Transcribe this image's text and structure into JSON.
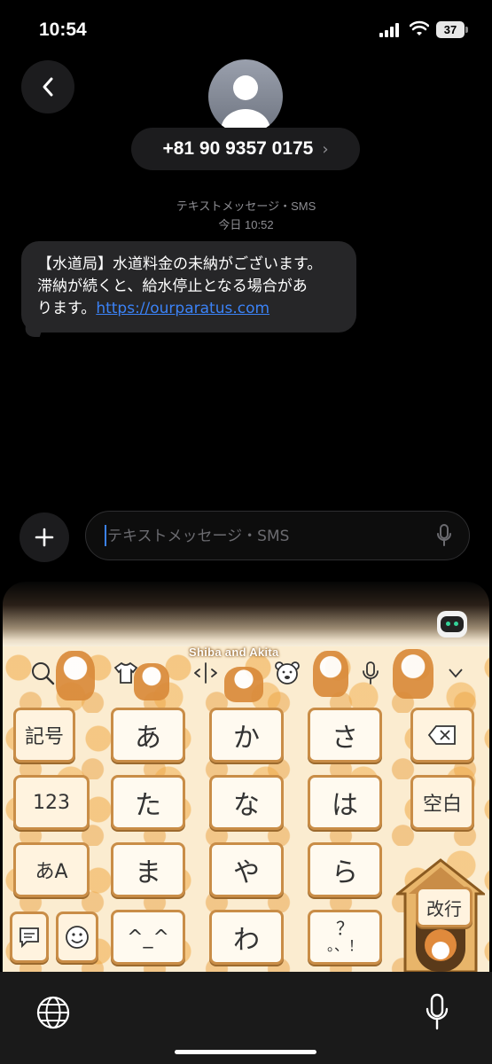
{
  "status": {
    "time": "10:54",
    "battery": "37"
  },
  "header": {
    "phone_number": "+81 90 9357 0175",
    "chevron": "›"
  },
  "conversation": {
    "label": "テキストメッセージ・SMS",
    "timestamp": "今日 10:52",
    "message": {
      "line1": "【水道局】水道料金の未納がございます。",
      "line2": "滞納が続くと、給水停止となる場合があ",
      "line3_prefix": "ります。",
      "link": "https://ourparatus.com"
    }
  },
  "compose": {
    "placeholder": "テキストメッセージ・SMS"
  },
  "keyboard": {
    "theme_title": "Shiba and Akita",
    "keys": {
      "symbols": "記号",
      "a": "あ",
      "ka": "か",
      "sa": "さ",
      "numbers": "123",
      "ta": "た",
      "na": "な",
      "ha": "は",
      "space": "空白",
      "kana_alpha": "あA",
      "ma": "ま",
      "ya": "や",
      "ra": "ら",
      "enter": "改行",
      "kaomoji": "^_^",
      "wa": "わ",
      "punct_top": "？",
      "punct_bottom": "。、！"
    }
  },
  "colors": {
    "accent": "#3b82f6",
    "bubble": "#262628",
    "key_border": "#c98d47"
  },
  "icons": [
    "back-icon",
    "person-icon",
    "chevron-right-icon",
    "plus-icon",
    "mic-icon",
    "search-icon",
    "shirt-icon",
    "cursor-icon",
    "bear-face-icon",
    "voice-mic-icon",
    "collapse-icon",
    "delete-icon",
    "speech-bubble-icon",
    "smiley-icon",
    "globe-icon",
    "dictation-mic-icon",
    "robot-icon"
  ]
}
